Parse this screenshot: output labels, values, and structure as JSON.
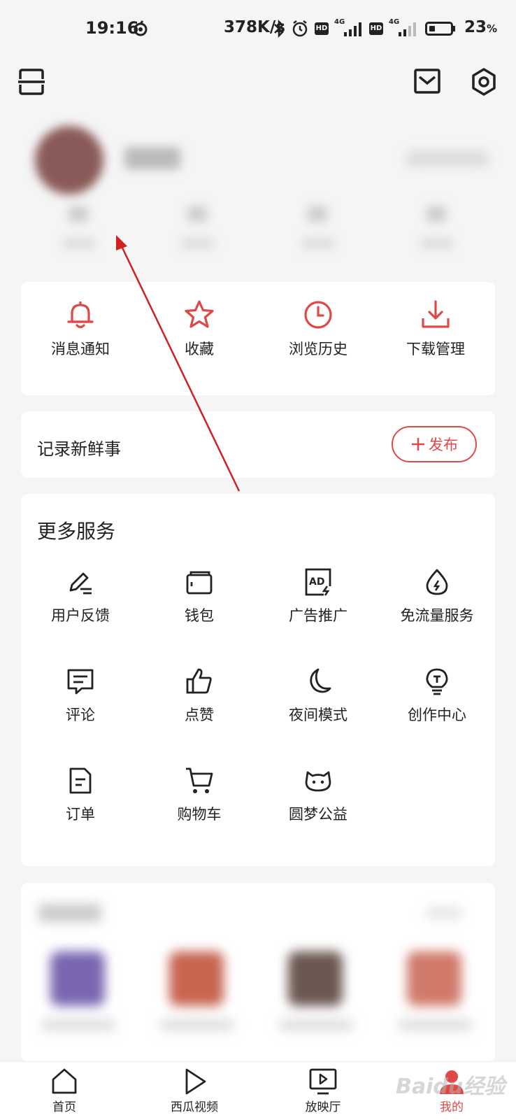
{
  "status_bar": {
    "time": "19:16",
    "net_rate": "378K/s",
    "battery_pct": "23",
    "battery_unit": "%",
    "signal1": "4G",
    "signal2": "4G",
    "hd1": "HD",
    "hd2": "HD"
  },
  "header": {
    "left_icon": "scan-icon",
    "mail_icon": "mail-icon",
    "settings_icon": "gear-icon"
  },
  "quick_actions": [
    {
      "label": "消息通知",
      "icon": "bell-icon"
    },
    {
      "label": "收藏",
      "icon": "star-icon"
    },
    {
      "label": "浏览历史",
      "icon": "clock-icon"
    },
    {
      "label": "下载管理",
      "icon": "download-icon"
    }
  ],
  "post": {
    "title": "记录新鲜事",
    "button_label": "发布"
  },
  "services": {
    "title": "更多服务",
    "items": [
      {
        "label": "用户反馈",
        "icon": "pen-icon"
      },
      {
        "label": "钱包",
        "icon": "wallet-icon"
      },
      {
        "label": "广告推广",
        "icon": "ad-icon"
      },
      {
        "label": "免流量服务",
        "icon": "drop-icon"
      },
      {
        "label": "评论",
        "icon": "comment-icon"
      },
      {
        "label": "点赞",
        "icon": "thumb-up-icon"
      },
      {
        "label": "夜间模式",
        "icon": "moon-icon"
      },
      {
        "label": "创作中心",
        "icon": "bulb-icon"
      },
      {
        "label": "订单",
        "icon": "document-icon"
      },
      {
        "label": "购物车",
        "icon": "cart-icon"
      },
      {
        "label": "圆梦公益",
        "icon": "cat-face-icon"
      }
    ]
  },
  "bottom_nav": [
    {
      "label": "首页",
      "icon": "home-icon"
    },
    {
      "label": "西瓜视频",
      "icon": "play-icon"
    },
    {
      "label": "放映厅",
      "icon": "tv-icon"
    },
    {
      "label": "我的",
      "icon": "profile-icon"
    }
  ],
  "watermark": "Baidu经验",
  "colors": {
    "accent": "#e04848",
    "background": "#f5f5f5",
    "card": "#ffffff",
    "annotation_arrow": "#d02020"
  }
}
